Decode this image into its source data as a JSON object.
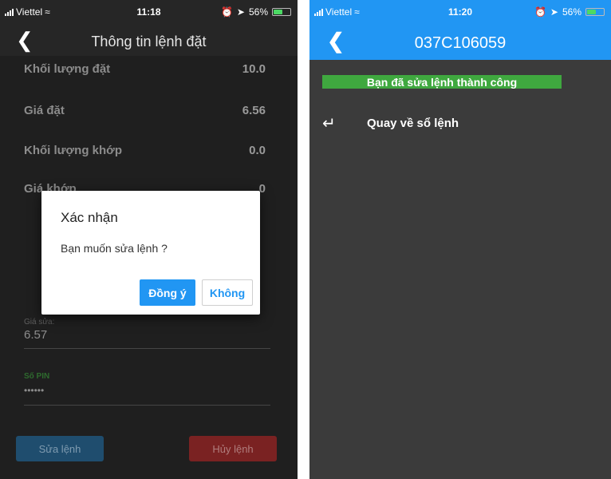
{
  "left": {
    "status": {
      "carrier": "Viettel",
      "time": "11:18",
      "battery": "56%"
    },
    "title": "Thông tin lệnh đặt",
    "rows": [
      {
        "label": "Khối lượng đặt",
        "value": "10.0"
      },
      {
        "label": "Giá đặt",
        "value": "6.56"
      },
      {
        "label": "Khối lượng khớp",
        "value": "0.0"
      },
      {
        "label": "Giá khớp",
        "value": "0"
      }
    ],
    "price_edit": {
      "label": "Giá sửa:",
      "value": "6.57"
    },
    "pin": {
      "label": "Số PIN",
      "value": "••••••"
    },
    "buttons": {
      "edit": "Sửa lệnh",
      "cancel": "Hủy lệnh"
    },
    "dialog": {
      "title": "Xác nhận",
      "message": "Bạn muốn sửa lệnh ?",
      "confirm": "Đồng ý",
      "decline": "Không"
    }
  },
  "right": {
    "status": {
      "carrier": "Viettel",
      "time": "11:20",
      "battery": "56%"
    },
    "title": "037C106059",
    "success_message": "Bạn đã sửa lệnh thành công",
    "return_label": "Quay về sổ lệnh"
  },
  "colors": {
    "accent": "#2196f3",
    "success": "#3fa83f",
    "danger": "#7a2222"
  }
}
